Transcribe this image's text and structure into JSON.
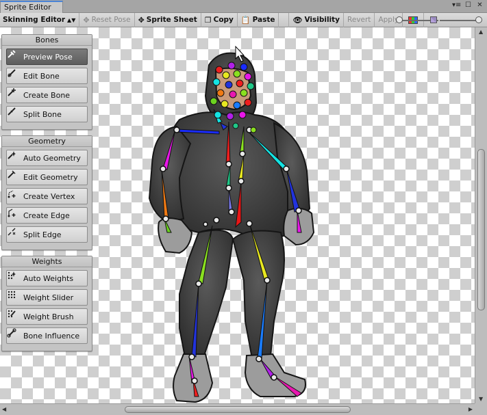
{
  "window": {
    "tab_title": "Sprite Editor"
  },
  "toolbar": {
    "mode_dropdown": "Skinning Editor",
    "reset_pose": "Reset Pose",
    "sprite_sheet": "Sprite Sheet",
    "copy": "Copy",
    "paste": "Paste",
    "visibility": "Visibility",
    "revert": "Revert",
    "apply": "Apply"
  },
  "panels": {
    "bones": {
      "title": "Bones",
      "buttons": [
        "Preview Pose",
        "Edit Bone",
        "Create Bone",
        "Split Bone"
      ],
      "active": "Preview Pose"
    },
    "geometry": {
      "title": "Geometry",
      "buttons": [
        "Auto Geometry",
        "Edit Geometry",
        "Create Vertex",
        "Create Edge",
        "Split Edge"
      ]
    },
    "weights": {
      "title": "Weights",
      "buttons": [
        "Auto Weights",
        "Weight Slider",
        "Weight Brush",
        "Bone Influence"
      ]
    }
  },
  "colors": {
    "active_button": "#666666",
    "tab_accent": "#4a83d6",
    "character_body": "#4a4a4a",
    "character_skin": "#9c9c9c"
  }
}
